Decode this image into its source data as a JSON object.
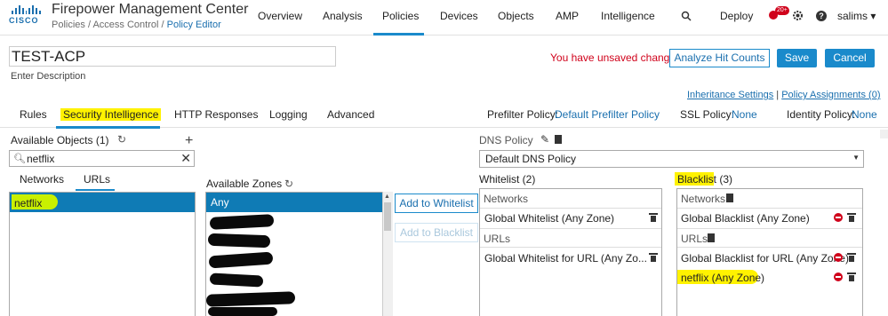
{
  "app": {
    "logo_text": "CISCO",
    "title": "Firepower Management Center",
    "breadcrumb": [
      "Policies",
      "Access Control",
      "Policy Editor"
    ]
  },
  "nav": {
    "items": [
      "Overview",
      "Analysis",
      "Policies",
      "Devices",
      "Objects",
      "AMP",
      "Intelligence"
    ],
    "active": "Policies",
    "deploy": "Deploy",
    "notification_count": "20+",
    "user": "salims ▾"
  },
  "policy": {
    "name": "TEST-ACP",
    "description_placeholder": "Enter Description",
    "unsaved_message": "You have unsaved changes",
    "analyze_button": "Analyze Hit Counts",
    "save_button": "Save",
    "cancel_button": "Cancel",
    "inheritance_link": "Inheritance Settings",
    "assignments_link": "Policy Assignments (0)"
  },
  "tabs": {
    "items": [
      "Rules",
      "Security Intelligence",
      "HTTP Responses",
      "Logging",
      "Advanced"
    ],
    "active": "Security Intelligence",
    "prefilter_label": "Prefilter Policy:",
    "prefilter_value": "Default Prefilter Policy",
    "ssl_label": "SSL Policy:",
    "ssl_value": "None",
    "identity_label": "Identity Policy:",
    "identity_value": "None"
  },
  "available_objects": {
    "title": "Available Objects (1)",
    "search_value": "netflix",
    "subtabs": [
      "Networks",
      "URLs"
    ],
    "active_subtab": "URLs",
    "items": [
      "netflix"
    ]
  },
  "available_zones": {
    "title": "Available Zones",
    "items": [
      "Any"
    ]
  },
  "actions": {
    "add_whitelist": "Add to Whitelist",
    "add_blacklist": "Add to Blacklist"
  },
  "dns": {
    "label": "DNS Policy",
    "selected": "Default DNS Policy"
  },
  "whitelist": {
    "title": "Whitelist (2)",
    "networks_header": "Networks",
    "networks": [
      "Global Whitelist (Any Zone)"
    ],
    "urls_header": "URLs",
    "urls": [
      "Global Whitelist for URL (Any Zo..."
    ]
  },
  "blacklist": {
    "title": "Blacklist (3)",
    "networks_header": "Networks",
    "networks": [
      "Global Blacklist (Any Zone)"
    ],
    "urls_header": "URLs",
    "urls": [
      "Global Blacklist for URL (Any Zone)",
      "netflix (Any Zone)"
    ]
  }
}
